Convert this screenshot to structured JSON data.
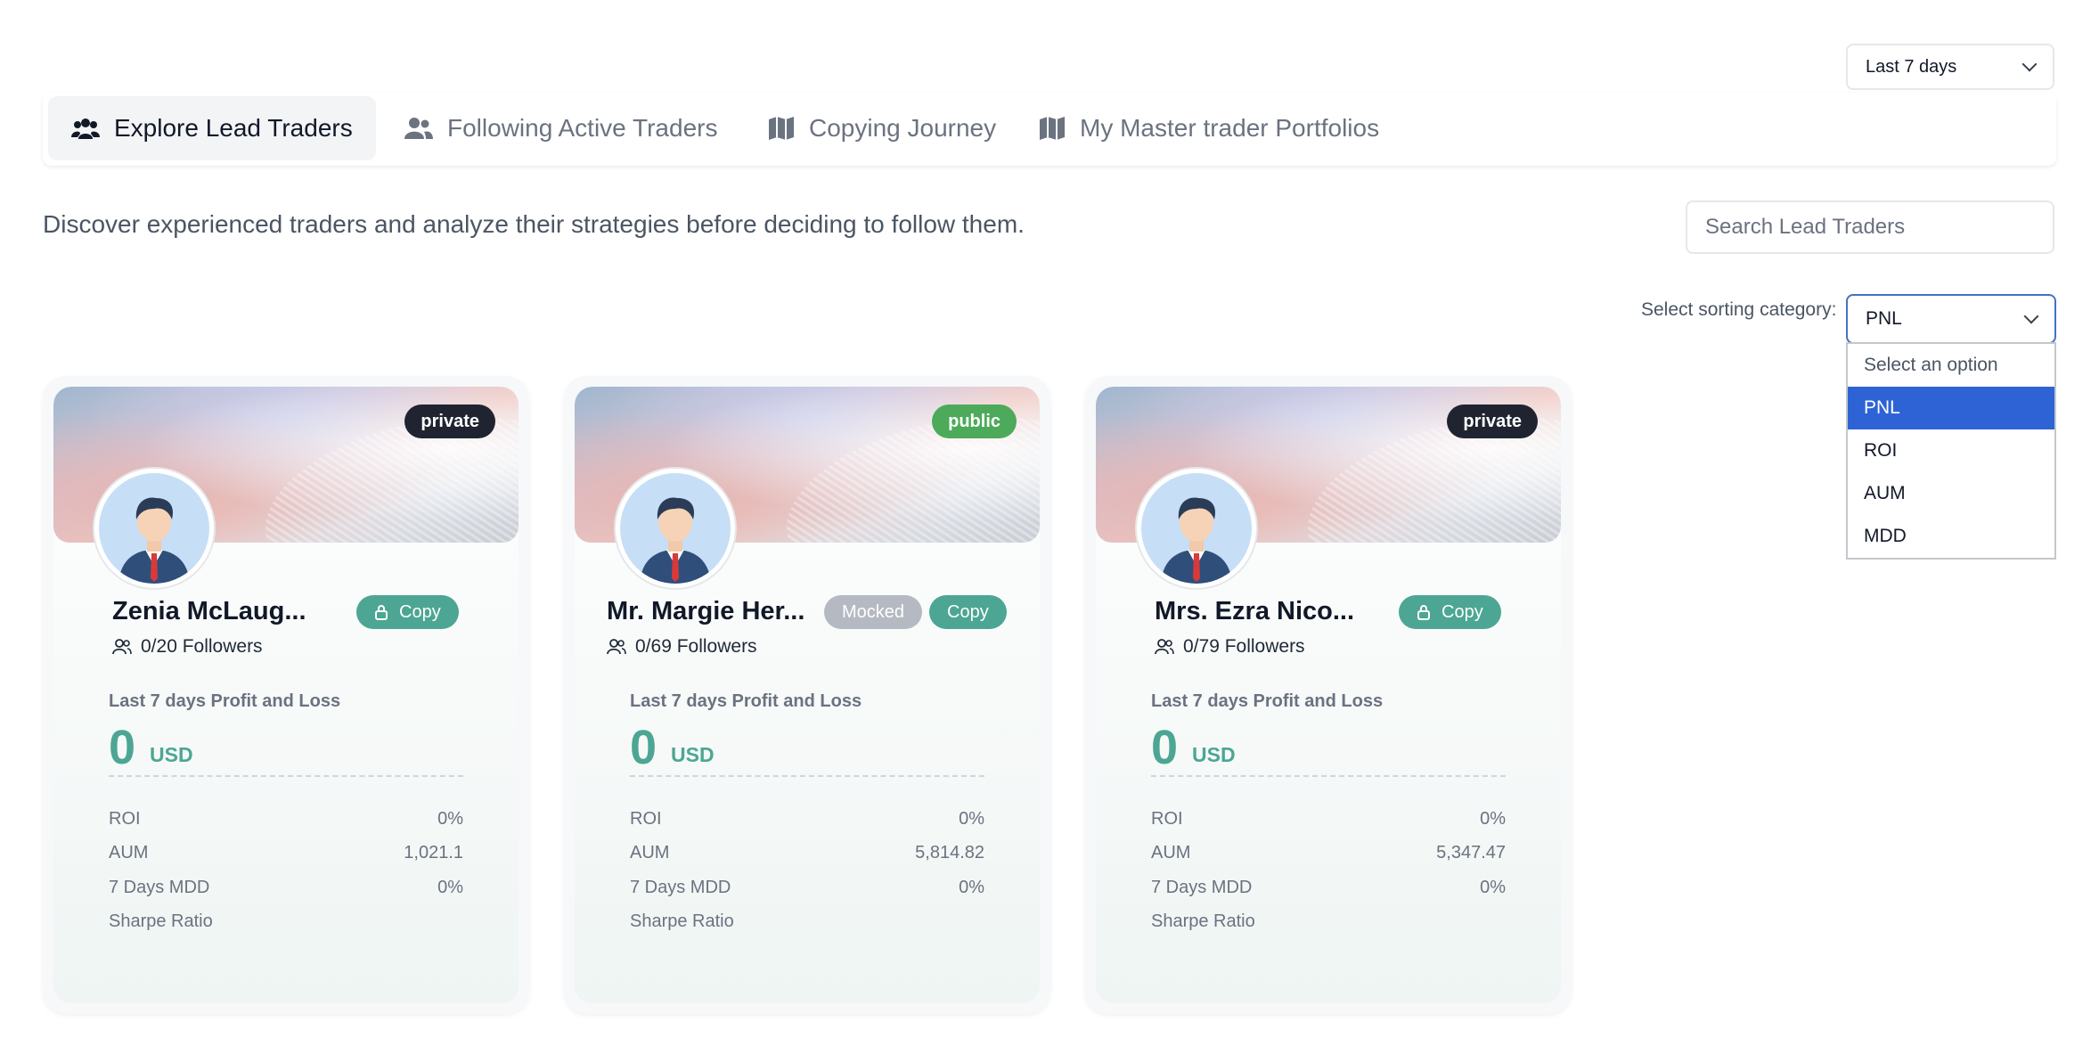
{
  "header": {
    "period_select": "Last 7 days"
  },
  "tabs": [
    {
      "label": "Explore Lead Traders",
      "icon": "users-icon"
    },
    {
      "label": "Following Active Traders",
      "icon": "user-group-icon"
    },
    {
      "label": "Copying Journey",
      "icon": "map-icon"
    },
    {
      "label": "My Master trader Portfolios",
      "icon": "map-icon"
    }
  ],
  "intro": "Discover experienced traders and analyze their strategies before deciding to follow them.",
  "search": {
    "placeholder": "Search Lead Traders"
  },
  "sorting": {
    "label": "Select sorting category:",
    "selected": "PNL",
    "options": [
      "Select an option",
      "PNL",
      "ROI",
      "AUM",
      "MDD"
    ]
  },
  "cards": [
    {
      "badge": "private",
      "name": "Zenia McLaug...",
      "followers": "0/20 Followers",
      "copy": "Copy",
      "pnl_label": "Last 7 days Profit and Loss",
      "pnl_value": "0",
      "pnl_unit": "USD",
      "roi_label": "ROI",
      "roi": "0%",
      "aum_label": "AUM",
      "aum": "1,021.1",
      "mdd_label": "7 Days MDD",
      "mdd": "0%",
      "sharpe_label": "Sharpe Ratio"
    },
    {
      "badge": "public",
      "name": "Mr. Margie Her...",
      "followers": "0/69 Followers",
      "mocked": "Mocked",
      "copy": "Copy",
      "pnl_label": "Last 7 days Profit and Loss",
      "pnl_value": "0",
      "pnl_unit": "USD",
      "roi_label": "ROI",
      "roi": "0%",
      "aum_label": "AUM",
      "aum": "5,814.82",
      "mdd_label": "7 Days MDD",
      "mdd": "0%",
      "sharpe_label": "Sharpe Ratio"
    },
    {
      "badge": "private",
      "name": "Mrs. Ezra Nico...",
      "followers": "0/79 Followers",
      "copy": "Copy",
      "pnl_label": "Last 7 days Profit and Loss",
      "pnl_value": "0",
      "pnl_unit": "USD",
      "roi_label": "ROI",
      "roi": "0%",
      "aum_label": "AUM",
      "aum": "5,347.47",
      "mdd_label": "7 Days MDD",
      "mdd": "0%",
      "sharpe_label": "Sharpe Ratio"
    }
  ],
  "colors": {
    "accent": "#4ca693",
    "selected_option": "#2e63d6",
    "private_badge": "#1f2430",
    "public_badge": "#4caa5a"
  }
}
